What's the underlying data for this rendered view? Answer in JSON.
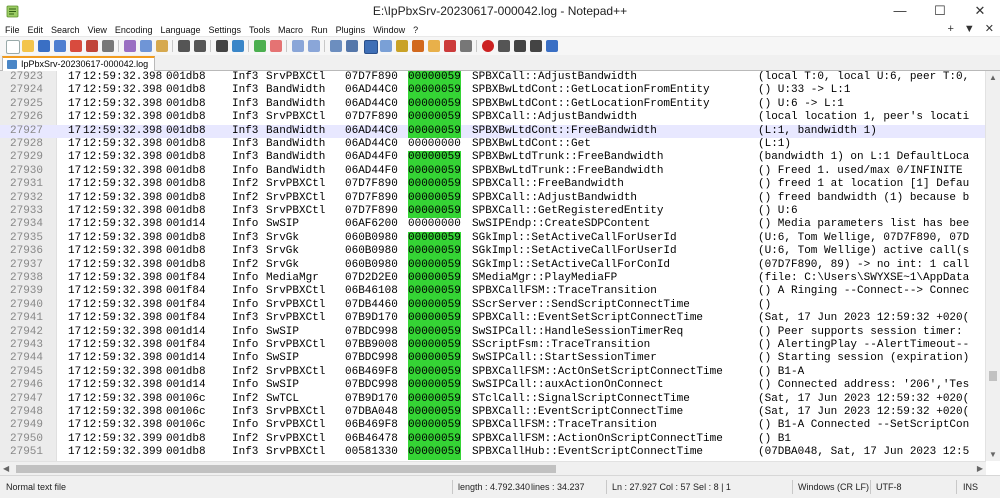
{
  "window": {
    "title": "E:\\IpPbxSrv-20230617-000042.log - Notepad++",
    "minimize": "—",
    "maximize": "☐",
    "close": "✕"
  },
  "menu": {
    "items": [
      "File",
      "Edit",
      "Search",
      "View",
      "Encoding",
      "Language",
      "Settings",
      "Tools",
      "Macro",
      "Run",
      "Plugins",
      "Window",
      "?"
    ],
    "right": [
      "+",
      "▼",
      "✕"
    ]
  },
  "tab": {
    "label": "IpPbxSrv-20230617-000042.log"
  },
  "editor": {
    "current_line": 27927,
    "lines": [
      {
        "n": "27923",
        "d": "17",
        "t": "12:59:32.398",
        "th": "001db8",
        "lvl": "Inf3",
        "mod": "SrvPBXCtl",
        "addr": "07D7F890",
        "id": "00000059",
        "hl": true,
        "fn": "SPBXCall::AdjustBandwidth",
        "msg": "(local T:0, local U:6, peer T:0,"
      },
      {
        "n": "27924",
        "d": "17",
        "t": "12:59:32.398",
        "th": "001db8",
        "lvl": "Inf3",
        "mod": "BandWidth",
        "addr": "06AD44C0",
        "id": "00000059",
        "hl": true,
        "fn": "SPBXBwLtdCont::GetLocationFromEntity",
        "msg": "() U:33 -> L:1"
      },
      {
        "n": "27925",
        "d": "17",
        "t": "12:59:32.398",
        "th": "001db8",
        "lvl": "Inf3",
        "mod": "BandWidth",
        "addr": "06AD44C0",
        "id": "00000059",
        "hl": true,
        "fn": "SPBXBwLtdCont::GetLocationFromEntity",
        "msg": "() U:6 -> L:1"
      },
      {
        "n": "27926",
        "d": "17",
        "t": "12:59:32.398",
        "th": "001db8",
        "lvl": "Inf3",
        "mod": "SrvPBXCtl",
        "addr": "07D7F890",
        "id": "00000059",
        "hl": true,
        "fn": "SPBXCall::AdjustBandwidth",
        "msg": "(local location 1, peer's locati"
      },
      {
        "n": "27927",
        "d": "17",
        "t": "12:59:32.398",
        "th": "001db8",
        "lvl": "Inf3",
        "mod": "BandWidth",
        "addr": "06AD44C0",
        "id": "00000059",
        "hl": true,
        "fn": "SPBXBwLtdCont::FreeBandwidth",
        "msg": "(L:1, bandwidth 1)"
      },
      {
        "n": "27928",
        "d": "17",
        "t": "12:59:32.398",
        "th": "001db8",
        "lvl": "Inf3",
        "mod": "BandWidth",
        "addr": "06AD44C0",
        "id": "00000000",
        "hl": false,
        "fn": "SPBXBwLtdCont::Get",
        "msg": "(L:1)"
      },
      {
        "n": "27929",
        "d": "17",
        "t": "12:59:32.398",
        "th": "001db8",
        "lvl": "Inf3",
        "mod": "BandWidth",
        "addr": "06AD44F0",
        "id": "00000059",
        "hl": true,
        "fn": "SPBXBwLtdTrunk::FreeBandwidth",
        "msg": "(bandwidth 1) on L:1 DefaultLoca"
      },
      {
        "n": "27930",
        "d": "17",
        "t": "12:59:32.398",
        "th": "001db8",
        "lvl": "Info",
        "mod": "BandWidth",
        "addr": "06AD44F0",
        "id": "00000059",
        "hl": true,
        "fn": "SPBXBwLtdTrunk::FreeBandwidth",
        "msg": "() Freed 1. used/max 0/INFINITE"
      },
      {
        "n": "27931",
        "d": "17",
        "t": "12:59:32.398",
        "th": "001db8",
        "lvl": "Inf2",
        "mod": "SrvPBXCtl",
        "addr": "07D7F890",
        "id": "00000059",
        "hl": true,
        "fn": "SPBXCall::FreeBandwidth",
        "msg": "() freed 1 at location [1] Defau"
      },
      {
        "n": "27932",
        "d": "17",
        "t": "12:59:32.398",
        "th": "001db8",
        "lvl": "Inf2",
        "mod": "SrvPBXCtl",
        "addr": "07D7F890",
        "id": "00000059",
        "hl": true,
        "fn": "SPBXCall::AdjustBandwidth",
        "msg": "() freed bandwidth (1) because b"
      },
      {
        "n": "27933",
        "d": "17",
        "t": "12:59:32.398",
        "th": "001db8",
        "lvl": "Inf3",
        "mod": "SrvPBXCtl",
        "addr": "07D7F890",
        "id": "00000059",
        "hl": true,
        "fn": "SPBXCall::GetRegisteredEntity",
        "msg": "() U:6"
      },
      {
        "n": "27934",
        "d": "17",
        "t": "12:59:32.398",
        "th": "001d14",
        "lvl": "Info",
        "mod": "SwSIP",
        "addr": "06AF6200",
        "id": "00000000",
        "hl": false,
        "fn": "SwSIPEndp::CreateSDPContent",
        "msg": "() Media parameters list has bee"
      },
      {
        "n": "27935",
        "d": "17",
        "t": "12:59:32.398",
        "th": "001db8",
        "lvl": "Inf3",
        "mod": "SrvGk",
        "addr": "060B0980",
        "id": "00000059",
        "hl": true,
        "fn": "SGkImpl::SetActiveCallForUserId",
        "msg": "(U:6, Tom Wellige, 07D7F890, 07D"
      },
      {
        "n": "27936",
        "d": "17",
        "t": "12:59:32.398",
        "th": "001db8",
        "lvl": "Inf3",
        "mod": "SrvGk",
        "addr": "060B0980",
        "id": "00000059",
        "hl": true,
        "fn": "SGkImpl::SetActiveCallForUserId",
        "msg": "(U:6, Tom Wellige) active call(s"
      },
      {
        "n": "27937",
        "d": "17",
        "t": "12:59:32.398",
        "th": "001db8",
        "lvl": "Inf2",
        "mod": "SrvGk",
        "addr": "060B0980",
        "id": "00000059",
        "hl": true,
        "fn": "SGkImpl::SetActiveCallForConId",
        "msg": "(07D7F890, 89) -> no int: 1 call"
      },
      {
        "n": "27938",
        "d": "17",
        "t": "12:59:32.398",
        "th": "001f84",
        "lvl": "Info",
        "mod": "MediaMgr",
        "addr": "07D2D2E0",
        "id": "00000059",
        "hl": true,
        "fn": "SMediaMgr::PlayMediaFP",
        "msg": "(file: C:\\Users\\SWYXSE~1\\AppData"
      },
      {
        "n": "27939",
        "d": "17",
        "t": "12:59:32.398",
        "th": "001f84",
        "lvl": "Info",
        "mod": "SrvPBXCtl",
        "addr": "06B46108",
        "id": "00000059",
        "hl": true,
        "fn": "SPBXCallFSM::TraceTransition",
        "msg": "() A Ringing --Connect--> Connec"
      },
      {
        "n": "27940",
        "d": "17",
        "t": "12:59:32.398",
        "th": "001f84",
        "lvl": "Info",
        "mod": "SrvPBXCtl",
        "addr": "07DB4460",
        "id": "00000059",
        "hl": true,
        "fn": "SScrServer::SendScriptConnectTime",
        "msg": "()"
      },
      {
        "n": "27941",
        "d": "17",
        "t": "12:59:32.398",
        "th": "001f84",
        "lvl": "Inf3",
        "mod": "SrvPBXCtl",
        "addr": "07B9D170",
        "id": "00000059",
        "hl": true,
        "fn": "SPBXCall::EventSetScriptConnectTime",
        "msg": "(Sat, 17 Jun 2023 12:59:32 +020("
      },
      {
        "n": "27942",
        "d": "17",
        "t": "12:59:32.398",
        "th": "001d14",
        "lvl": "Info",
        "mod": "SwSIP",
        "addr": "07BDC998",
        "id": "00000059",
        "hl": true,
        "fn": "SwSIPCall::HandleSessionTimerReq",
        "msg": "() Peer supports session timer:"
      },
      {
        "n": "27943",
        "d": "17",
        "t": "12:59:32.398",
        "th": "001f84",
        "lvl": "Info",
        "mod": "SrvPBXCtl",
        "addr": "07BB9008",
        "id": "00000059",
        "hl": true,
        "fn": "SScriptFsm::TraceTransition",
        "msg": "() AlertingPlay --AlertTimeout--"
      },
      {
        "n": "27944",
        "d": "17",
        "t": "12:59:32.398",
        "th": "001d14",
        "lvl": "Info",
        "mod": "SwSIP",
        "addr": "07BDC998",
        "id": "00000059",
        "hl": true,
        "fn": "SwSIPCall::StartSessionTimer",
        "msg": "() Starting session (expiration)"
      },
      {
        "n": "27945",
        "d": "17",
        "t": "12:59:32.398",
        "th": "001db8",
        "lvl": "Inf2",
        "mod": "SrvPBXCtl",
        "addr": "06B469F8",
        "id": "00000059",
        "hl": true,
        "fn": "SPBXCallFSM::ActOnSetScriptConnectTime",
        "msg": "() B1-A"
      },
      {
        "n": "27946",
        "d": "17",
        "t": "12:59:32.398",
        "th": "001d14",
        "lvl": "Info",
        "mod": "SwSIP",
        "addr": "07BDC998",
        "id": "00000059",
        "hl": true,
        "fn": "SwSIPCall::auxActionOnConnect",
        "msg": "() Connected address: '206','Tes"
      },
      {
        "n": "27947",
        "d": "17",
        "t": "12:59:32.398",
        "th": "00106c",
        "lvl": "Inf2",
        "mod": "SwTCL",
        "addr": "07B9D170",
        "id": "00000059",
        "hl": true,
        "fn": "STclCall::SignalScriptConnectTime",
        "msg": "(Sat, 17 Jun 2023 12:59:32 +020("
      },
      {
        "n": "27948",
        "d": "17",
        "t": "12:59:32.398",
        "th": "00106c",
        "lvl": "Inf3",
        "mod": "SrvPBXCtl",
        "addr": "07DBA048",
        "id": "00000059",
        "hl": true,
        "fn": "SPBXCall::EventScriptConnectTime",
        "msg": "(Sat, 17 Jun 2023 12:59:32 +020("
      },
      {
        "n": "27949",
        "d": "17",
        "t": "12:59:32.398",
        "th": "00106c",
        "lvl": "Info",
        "mod": "SrvPBXCtl",
        "addr": "06B469F8",
        "id": "00000059",
        "hl": true,
        "fn": "SPBXCallFSM::TraceTransition",
        "msg": "() B1-A Connected --SetScriptCon"
      },
      {
        "n": "27950",
        "d": "17",
        "t": "12:59:32.399",
        "th": "001db8",
        "lvl": "Inf2",
        "mod": "SrvPBXCtl",
        "addr": "06B46478",
        "id": "00000059",
        "hl": true,
        "fn": "SPBXCallFSM::ActionOnScriptConnectTime",
        "msg": "() B1"
      },
      {
        "n": "27951",
        "d": "17",
        "t": "12:59:32.399",
        "th": "001db8",
        "lvl": "Inf3",
        "mod": "SrvPBXCtl",
        "addr": "00581330",
        "id": "00000059",
        "hl": true,
        "fn": "SPBXCallHub::EventScriptConnectTime",
        "msg": "(07DBA048, Sat, 17 Jun 2023 12:5"
      }
    ]
  },
  "status": {
    "type": "Normal text file",
    "length": "length : 4.792.340",
    "lines": "lines : 34.237",
    "position": "Ln : 27.927   Col : 57   Sel : 8 | 1",
    "eol": "Windows (CR LF)",
    "encoding": "UTF-8",
    "mode": "INS"
  },
  "colors": {
    "id_highlight": "#35d435",
    "current_line": "#e8e8ff",
    "gutter": "#ececec"
  }
}
